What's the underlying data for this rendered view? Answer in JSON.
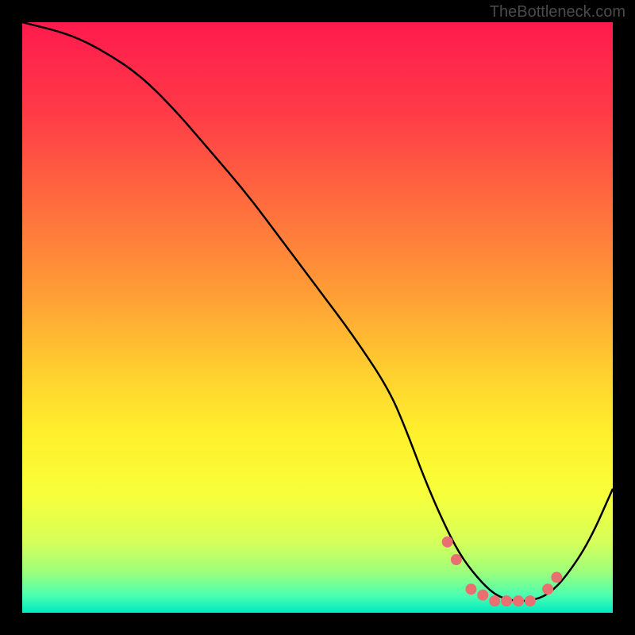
{
  "attribution": "TheBottleneck.com",
  "chart_data": {
    "type": "line",
    "title": "",
    "xlabel": "",
    "ylabel": "",
    "xlim": [
      0,
      100
    ],
    "ylim": [
      0,
      100
    ],
    "series": [
      {
        "name": "curve",
        "x": [
          0,
          8,
          14,
          20,
          26,
          32,
          38,
          44,
          50,
          56,
          62,
          65,
          68,
          71,
          74,
          77,
          80,
          83,
          86,
          89,
          92,
          96,
          100
        ],
        "y": [
          100,
          98,
          95,
          91,
          85,
          78,
          71,
          63,
          55,
          47,
          38,
          31,
          23,
          16,
          10,
          6,
          3,
          2,
          2,
          3,
          6,
          12,
          21
        ]
      }
    ],
    "highlight_dots": {
      "x": [
        72,
        73.5,
        76,
        78,
        80,
        82,
        84,
        86,
        89,
        90.5
      ],
      "y": [
        12,
        9,
        4,
        3,
        2,
        2,
        2,
        2,
        4,
        6
      ]
    },
    "gradient_stops": [
      {
        "offset": 0.0,
        "color": "#ff1a4d"
      },
      {
        "offset": 0.15,
        "color": "#ff3a47"
      },
      {
        "offset": 0.3,
        "color": "#ff6a3e"
      },
      {
        "offset": 0.45,
        "color": "#ff9a36"
      },
      {
        "offset": 0.6,
        "color": "#ffd22f"
      },
      {
        "offset": 0.7,
        "color": "#fff02c"
      },
      {
        "offset": 0.8,
        "color": "#f8ff3a"
      },
      {
        "offset": 0.88,
        "color": "#d6ff5a"
      },
      {
        "offset": 0.93,
        "color": "#9eff7a"
      },
      {
        "offset": 0.97,
        "color": "#4dffb0"
      },
      {
        "offset": 1.0,
        "color": "#00e8c0"
      }
    ]
  }
}
